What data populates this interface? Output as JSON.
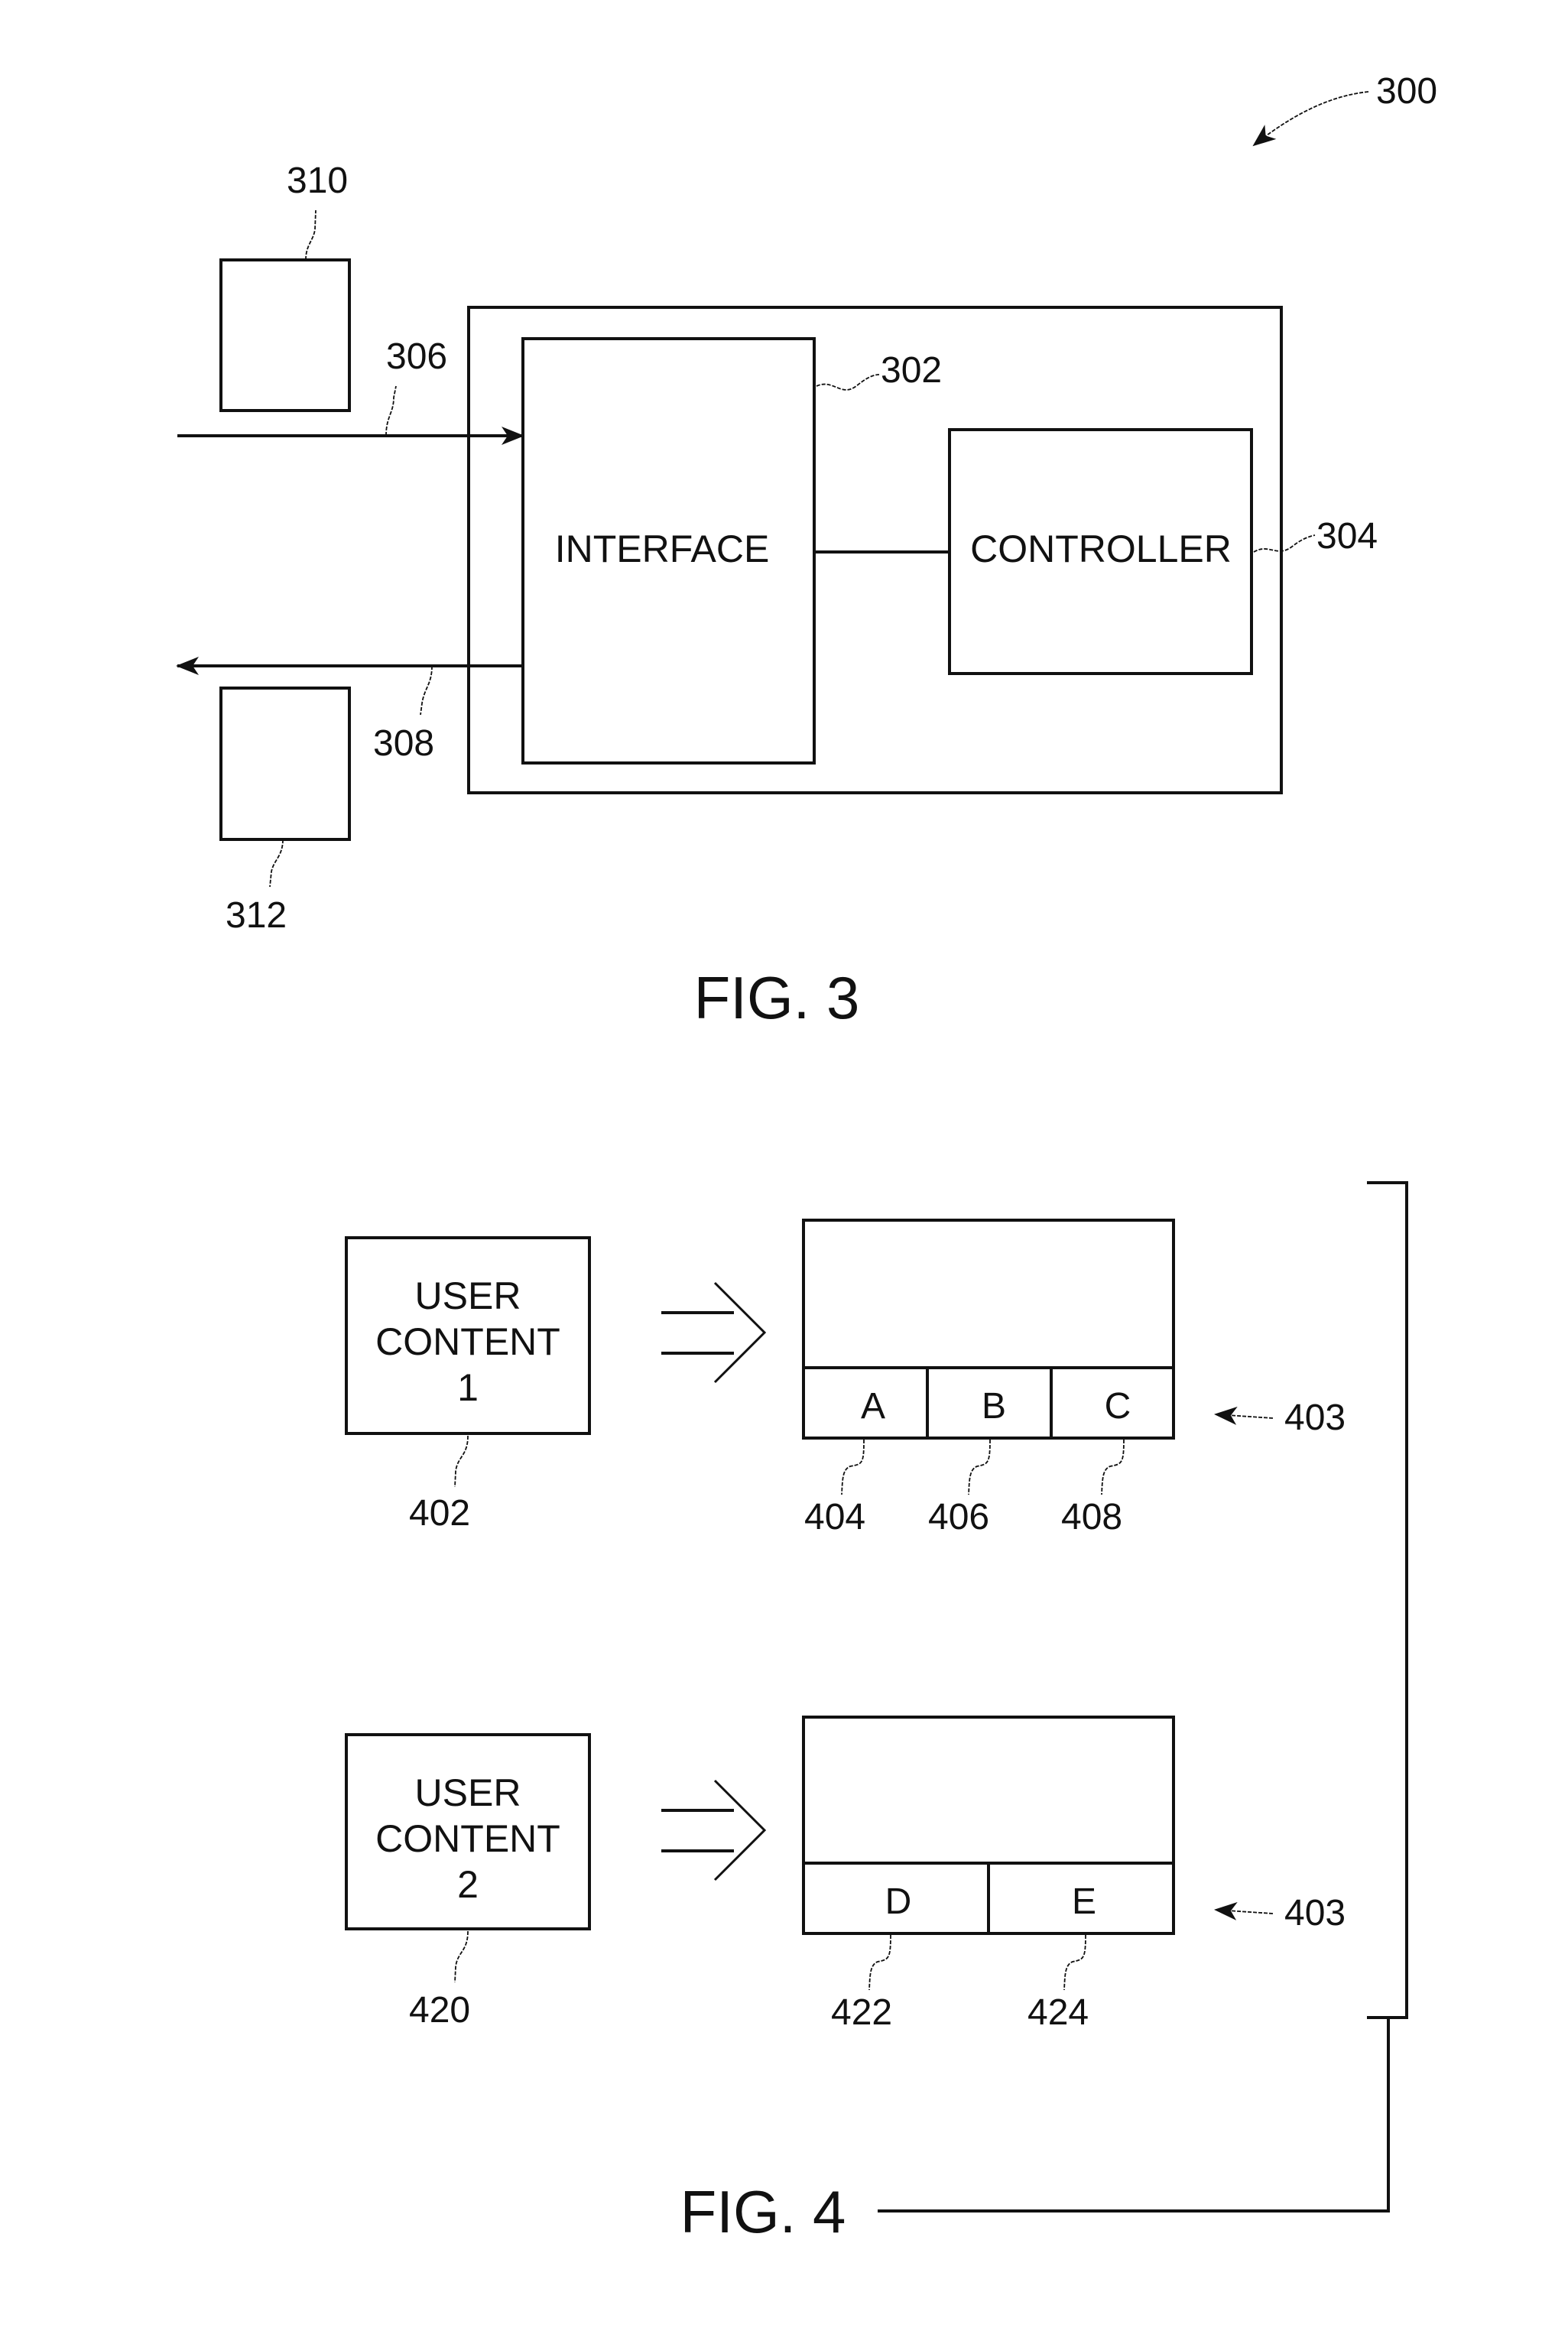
{
  "fig3": {
    "caption": "FIG. 3",
    "system_ref": "300",
    "interface": {
      "label": "INTERFACE",
      "ref": "302"
    },
    "controller": {
      "label": "CONTROLLER",
      "ref": "304"
    },
    "input_arrow_ref": "306",
    "output_arrow_ref": "308",
    "input_device_ref": "310",
    "output_device_ref": "312"
  },
  "fig4": {
    "caption": "FIG. 4",
    "rows": [
      {
        "content_lines": [
          "USER",
          "CONTENT",
          "1"
        ],
        "content_ref": "402",
        "display_ref": "403",
        "cells": [
          {
            "label": "A",
            "ref": "404"
          },
          {
            "label": "B",
            "ref": "406"
          },
          {
            "label": "C",
            "ref": "408"
          }
        ]
      },
      {
        "content_lines": [
          "USER",
          "CONTENT",
          "2"
        ],
        "content_ref": "420",
        "display_ref": "403",
        "cells": [
          {
            "label": "D",
            "ref": "422"
          },
          {
            "label": "E",
            "ref": "424"
          }
        ]
      }
    ]
  }
}
